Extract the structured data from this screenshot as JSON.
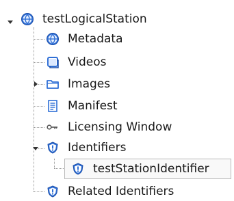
{
  "tree": {
    "root": {
      "label": "testLogicalStation",
      "icon": "globe-icon",
      "expanded": true
    },
    "items": [
      {
        "label": "Metadata",
        "icon": "globe-icon"
      },
      {
        "label": "Videos",
        "icon": "window-icon"
      },
      {
        "label": "Images",
        "icon": "folder-icon",
        "expanded": false
      },
      {
        "label": "Manifest",
        "icon": "document-icon"
      },
      {
        "label": "Licensing Window",
        "icon": "key-icon"
      },
      {
        "label": "Identifiers",
        "icon": "shield-icon",
        "expanded": true,
        "children": [
          {
            "label": "testStationIdentifier",
            "icon": "shield-icon",
            "selected": true
          }
        ]
      },
      {
        "label": "Related Identifiers",
        "icon": "shield-icon"
      }
    ]
  },
  "colors": {
    "accent": "#2f6fd6",
    "line": "#9a9a9a",
    "selection_border": "#b9b9b9"
  }
}
